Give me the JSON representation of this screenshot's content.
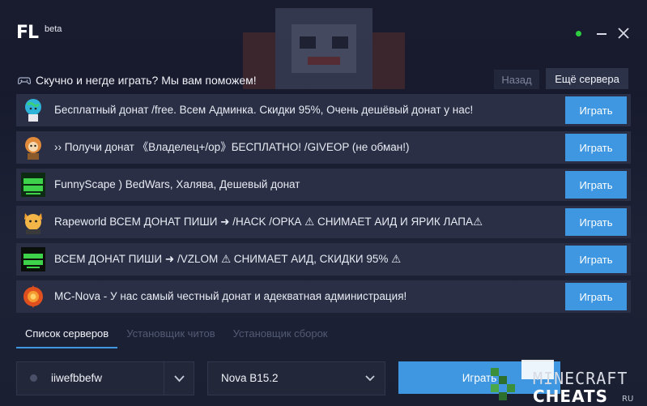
{
  "app": {
    "logo": "FL",
    "badge": "beta"
  },
  "window": {
    "status_color": "#2ecc40"
  },
  "promo": {
    "text": "Скучно и негде играть? Мы вам поможем!"
  },
  "nav": {
    "back_label": "Назад",
    "more_label": "Ещё сервера"
  },
  "servers": [
    {
      "name": "Бесплатный донат /free. Всем Админка. Скидки 95%, Очень дешёвый донат у нас!",
      "action": "Играть",
      "icon": "globe-character-icon"
    },
    {
      "name": "›› Получи донат 《Владелец+/op》БЕСПЛАТНО! /GIVEOP (не обман!)",
      "action": "Играть",
      "icon": "fox-character-icon"
    },
    {
      "name": "FunnyScape ) BedWars, Халява, Дешевый донат",
      "action": "Играть",
      "icon": "vsem-donat-logo-icon"
    },
    {
      "name": "Rapeworld ВСЕМ ДОНАТ ПИШИ ➜ /HACK /ОРКА ⚠ СНИМАЕТ АИД И ЯРИК ЛАПА⚠",
      "action": "Играть",
      "icon": "cat-character-icon"
    },
    {
      "name": "ВСЕМ ДОНАТ ПИШИ ➜ /VZLOM ⚠ СНИМАЕТ АИД, СКИДКИ 95% ⚠",
      "action": "Играть",
      "icon": "vsem-donat-logo-icon"
    },
    {
      "name": "MC-Nova - У нас самый честный донат и адекватная администрация!",
      "action": "Играть",
      "icon": "nova-flame-logo-icon"
    }
  ],
  "tabs": [
    {
      "label": "Список серверов",
      "active": true
    },
    {
      "label": "Установщик читов",
      "active": false
    },
    {
      "label": "Установщик сборок",
      "active": false
    }
  ],
  "account": {
    "username": "iiwefbbefw"
  },
  "version": {
    "selected": "Nova B15.2"
  },
  "launch": {
    "label": "Играть"
  },
  "watermark": {
    "line1": "MINECRAFT",
    "line2": "CHEATS",
    "suffix": "RU"
  },
  "colors": {
    "accent": "#3e97e0",
    "row_bg": "#2a2f45",
    "background": "#1b1f32"
  }
}
